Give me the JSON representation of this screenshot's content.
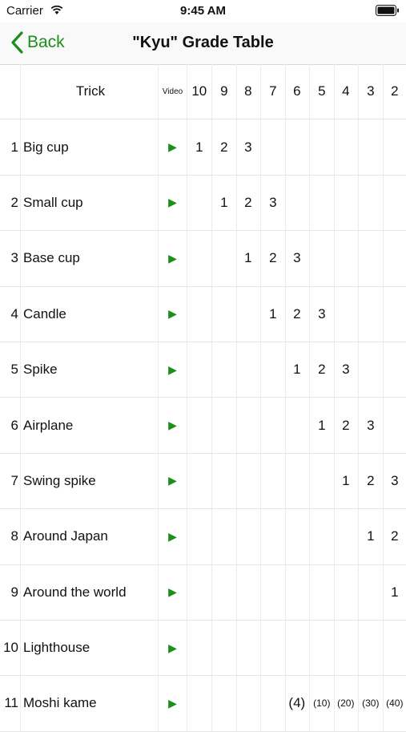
{
  "status_bar": {
    "carrier": "Carrier",
    "time": "9:45 AM"
  },
  "nav": {
    "back_label": "Back",
    "title": "\"Kyu\" Grade Table"
  },
  "table": {
    "headers": {
      "trick": "Trick",
      "video": "Video",
      "grades": [
        "10",
        "9",
        "8",
        "7",
        "6",
        "5",
        "4",
        "3",
        "2"
      ]
    },
    "play_icon": "▶",
    "rows": [
      {
        "num": "1",
        "name": "Big cup",
        "cells": [
          "1",
          "2",
          "3",
          "",
          "",
          "",
          "",
          "",
          ""
        ]
      },
      {
        "num": "2",
        "name": "Small cup",
        "cells": [
          "",
          "1",
          "2",
          "3",
          "",
          "",
          "",
          "",
          ""
        ]
      },
      {
        "num": "3",
        "name": "Base cup",
        "cells": [
          "",
          "",
          "1",
          "2",
          "3",
          "",
          "",
          "",
          ""
        ]
      },
      {
        "num": "4",
        "name": "Candle",
        "cells": [
          "",
          "",
          "",
          "1",
          "2",
          "3",
          "",
          "",
          ""
        ]
      },
      {
        "num": "5",
        "name": "Spike",
        "cells": [
          "",
          "",
          "",
          "",
          "1",
          "2",
          "3",
          "",
          ""
        ]
      },
      {
        "num": "6",
        "name": "Airplane",
        "cells": [
          "",
          "",
          "",
          "",
          "",
          "1",
          "2",
          "3",
          ""
        ]
      },
      {
        "num": "7",
        "name": "Swing spike",
        "cells": [
          "",
          "",
          "",
          "",
          "",
          "",
          "1",
          "2",
          "3"
        ]
      },
      {
        "num": "8",
        "name": "Around Japan",
        "cells": [
          "",
          "",
          "",
          "",
          "",
          "",
          "",
          "1",
          "2"
        ]
      },
      {
        "num": "9",
        "name": "Around the world",
        "cells": [
          "",
          "",
          "",
          "",
          "",
          "",
          "",
          "",
          "1"
        ]
      },
      {
        "num": "10",
        "name": "Lighthouse",
        "cells": [
          "",
          "",
          "",
          "",
          "",
          "",
          "",
          "",
          ""
        ]
      },
      {
        "num": "11",
        "name": "Moshi kame",
        "cells": [
          "",
          "",
          "",
          "",
          "(4)",
          "(10)",
          "(20)",
          "(30)",
          "(40)"
        ]
      }
    ]
  },
  "colors": {
    "accent": "#1a8f1a"
  }
}
